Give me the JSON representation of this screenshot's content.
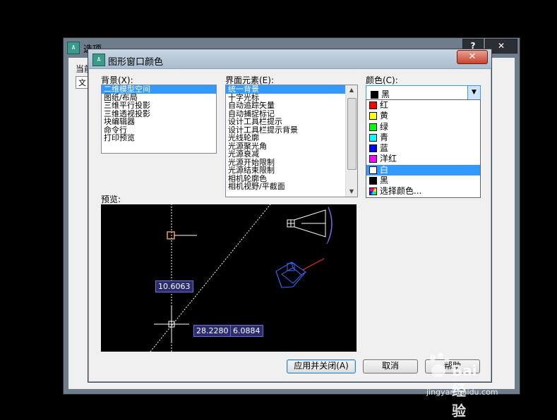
{
  "back_window": {
    "title": "选项",
    "help_btn": "?",
    "close_btn": "✕",
    "current_label": "当前",
    "tab_label": "文"
  },
  "dialog": {
    "title": "图形窗口颜色",
    "close": "✕",
    "context": {
      "label": "背景(X):",
      "items": [
        "二维模型空间",
        "图纸/布局",
        "三维平行投影",
        "三维透视投影",
        "块编辑器",
        "命令行",
        "打印预览"
      ],
      "selected_index": 0
    },
    "interface": {
      "label": "界面元素(E):",
      "items": [
        "统一背景",
        "十字光标",
        "自动追踪矢量",
        "自动捕捉标记",
        "设计工具栏提示",
        "设计工具栏提示背景",
        "光线轮廓",
        "光源聚光角",
        "光源衰减",
        "光源开始限制",
        "光源结束限制",
        "相机轮廓色",
        "相机视野/平截面"
      ],
      "selected_index": 0
    },
    "color": {
      "label": "颜色(C):",
      "value": "黑",
      "options": [
        {
          "label": "红",
          "color": "#ff0000"
        },
        {
          "label": "黄",
          "color": "#ffff00"
        },
        {
          "label": "绿",
          "color": "#00ff00"
        },
        {
          "label": "青",
          "color": "#00ffff"
        },
        {
          "label": "蓝",
          "color": "#0000ff"
        },
        {
          "label": "洋红",
          "color": "#ff00ff"
        },
        {
          "label": "白",
          "color": "#ffffff"
        },
        {
          "label": "黑",
          "color": "#000000"
        },
        {
          "label": "选择颜色...",
          "color": "rainbow"
        }
      ],
      "highlighted_index": 6
    },
    "preview": {
      "label": "预览:",
      "dim1": "10.6063",
      "dim2": "28.2280",
      "dim3": "6.0884"
    },
    "buttons": {
      "apply_close": "应用并关闭(A)",
      "cancel": "取消",
      "help": "帮助"
    }
  },
  "watermark": {
    "text": "Bai 经验",
    "url": "jingyan.baidu.com"
  }
}
